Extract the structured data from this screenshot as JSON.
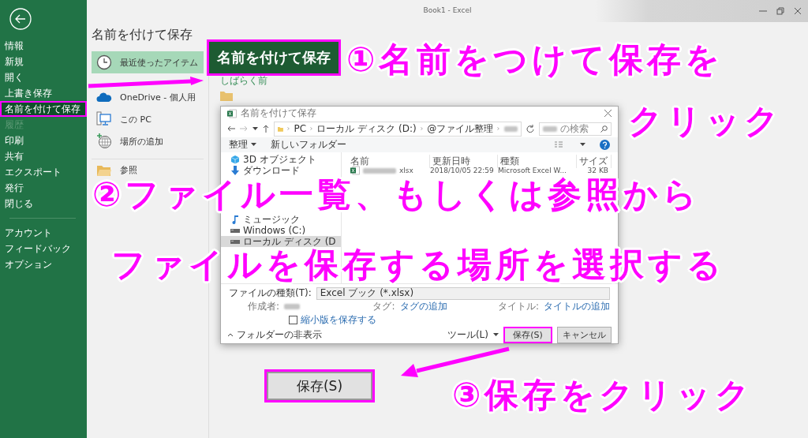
{
  "window": {
    "title": "Book1  -  Excel"
  },
  "sidebar": {
    "items": [
      {
        "label": "情報",
        "selected": false,
        "disabled": false,
        "highlighted": false
      },
      {
        "label": "新規",
        "selected": false,
        "disabled": false,
        "highlighted": false
      },
      {
        "label": "開く",
        "selected": false,
        "disabled": false,
        "highlighted": false
      },
      {
        "label": "上書き保存",
        "selected": false,
        "disabled": false,
        "highlighted": false
      },
      {
        "label": "名前を付けて保存",
        "selected": true,
        "disabled": false,
        "highlighted": true
      },
      {
        "label": "履歴",
        "selected": false,
        "disabled": true,
        "highlighted": false
      },
      {
        "label": "印刷",
        "selected": false,
        "disabled": false,
        "highlighted": false
      },
      {
        "label": "共有",
        "selected": false,
        "disabled": false,
        "highlighted": false
      },
      {
        "label": "エクスポート",
        "selected": false,
        "disabled": false,
        "highlighted": false
      },
      {
        "label": "発行",
        "selected": false,
        "disabled": false,
        "highlighted": false
      },
      {
        "label": "閉じる",
        "selected": false,
        "disabled": false,
        "highlighted": false
      }
    ],
    "footer_items": [
      {
        "label": "アカウント",
        "selected": false
      },
      {
        "label": "フィードバック",
        "selected": false
      },
      {
        "label": "オプション",
        "selected": false
      }
    ]
  },
  "page_title": "名前を付けて保存",
  "locations": [
    {
      "label": "最近使ったアイテム",
      "kind": "recent",
      "selected": true
    },
    {
      "label": "OneDrive - 個人用",
      "kind": "cloud",
      "selected": false
    },
    {
      "label": "この PC",
      "kind": "pc",
      "selected": false
    },
    {
      "label": "場所の追加",
      "kind": "add",
      "selected": false
    },
    {
      "label": "参照",
      "kind": "browse",
      "selected": false
    }
  ],
  "recent": {
    "group_label": "しばらく前"
  },
  "dialog": {
    "title": "名前を付けて保存",
    "breadcrumb": [
      "PC",
      "ローカル ディスク (D:)",
      "@ファイル整理"
    ],
    "search_placeholder": "の検索",
    "toolbar": [
      "整理",
      "新しいフォルダー"
    ],
    "nav": [
      {
        "label": "3D オブジェクト",
        "kind": "objects3d",
        "selected": false
      },
      {
        "label": "ダウンロード",
        "kind": "download",
        "selected": false
      },
      {
        "label": "ミュージック",
        "kind": "music",
        "selected": false
      },
      {
        "label": "Windows (C:)",
        "kind": "drive",
        "selected": false
      },
      {
        "label": "ローカル ディスク (D",
        "kind": "drive",
        "selected": true
      }
    ],
    "columns": [
      "名前",
      "更新日時",
      "種類",
      "サイズ"
    ],
    "files": [
      {
        "name": "xlsx",
        "modified": "2018/10/05 22:59",
        "type": "Microsoft Excel W...",
        "size": "32 KB"
      }
    ],
    "file_type": {
      "label": "ファイルの種類(T):",
      "value": "Excel ブック (*.xlsx)"
    },
    "meta": [
      {
        "label": "作成者:"
      },
      {
        "label": "タグ:",
        "value": "タグの追加"
      },
      {
        "label": "タイトル:",
        "value": "タイトルの追加"
      }
    ],
    "thumbnail": {
      "label": "縮小版を保存する",
      "checked": false
    },
    "hide_folders": "フォルダーの非表示",
    "tools": "ツール(L)",
    "buttons": [
      {
        "label": "保存(S)",
        "highlighted": true
      },
      {
        "label": "キャンセル",
        "highlighted": false
      }
    ]
  },
  "annotations": [
    {
      "kind": "callout",
      "text": "名前を付けて保存"
    },
    {
      "kind": "caption",
      "text": "①名前をつけて保存を"
    },
    {
      "kind": "caption",
      "text": "クリック"
    },
    {
      "kind": "caption",
      "text": "②ファイル一覧、もしくは参照から"
    },
    {
      "kind": "caption",
      "text": "ファイルを保存する場所を選択する"
    },
    {
      "kind": "button",
      "text": "保存(S)"
    },
    {
      "kind": "caption",
      "text": "③保存をクリック"
    }
  ]
}
